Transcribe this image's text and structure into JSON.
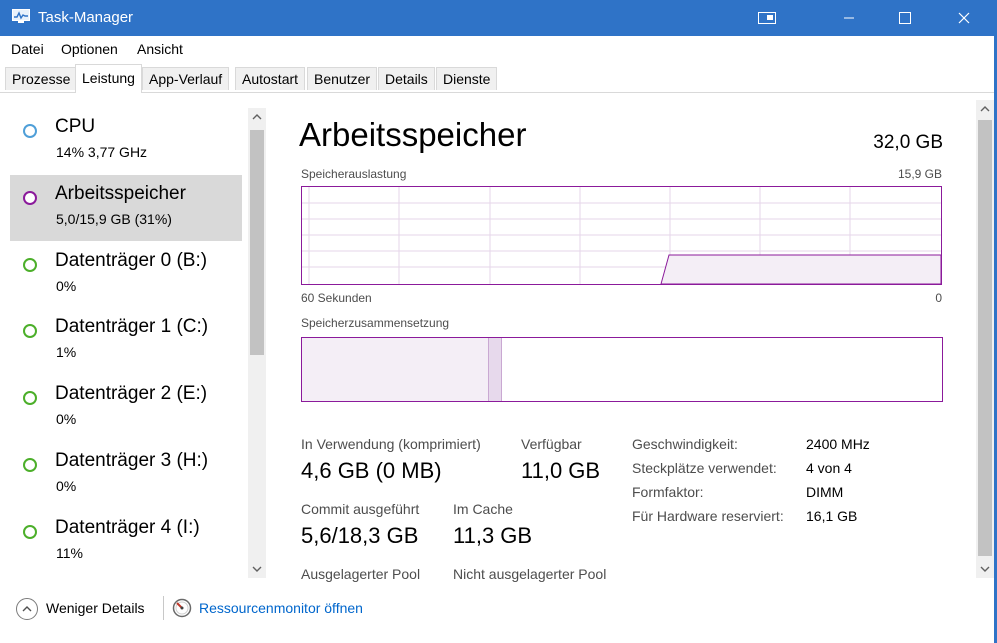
{
  "window": {
    "title": "Task-Manager"
  },
  "menu": [
    "Datei",
    "Optionen",
    "Ansicht"
  ],
  "tabs": [
    {
      "label": "Prozesse"
    },
    {
      "label": "Leistung",
      "active": true
    },
    {
      "label": "App-Verlauf"
    },
    {
      "label": "Autostart"
    },
    {
      "label": "Benutzer"
    },
    {
      "label": "Details"
    },
    {
      "label": "Dienste"
    }
  ],
  "resources": [
    {
      "name": "CPU",
      "sub": "14%  3,77 GHz",
      "color": "#4f9fd8"
    },
    {
      "name": "Arbeitsspeicher",
      "sub": "5,0/15,9 GB (31%)",
      "color": "#8b1a9b",
      "selected": true
    },
    {
      "name": "Datenträger 0 (B:)",
      "sub": "0%",
      "color": "#4caf2a"
    },
    {
      "name": "Datenträger 1 (C:)",
      "sub": "1%",
      "color": "#4caf2a"
    },
    {
      "name": "Datenträger 2 (E:)",
      "sub": "0%",
      "color": "#4caf2a"
    },
    {
      "name": "Datenträger 3 (H:)",
      "sub": "0%",
      "color": "#4caf2a"
    },
    {
      "name": "Datenträger 4 (I:)",
      "sub": "11%",
      "color": "#4caf2a"
    }
  ],
  "main": {
    "title": "Arbeitsspeicher",
    "total": "32,0 GB",
    "usage_label": "Speicherauslastung",
    "usage_max": "15,9 GB",
    "time_left": "60 Sekunden",
    "time_right": "0",
    "composition_label": "Speicherzusammensetzung",
    "accent_color": "#8b1a9b",
    "usage_fraction": 0.31
  },
  "stats": {
    "in_use_label": "In Verwendung (komprimiert)",
    "in_use_value": "4,6 GB (0 MB)",
    "available_label": "Verfügbar",
    "available_value": "11,0 GB",
    "commit_label": "Commit ausgeführt",
    "commit_value": "5,6/18,3 GB",
    "cache_label": "Im Cache",
    "cache_value": "11,3 GB",
    "paged_label": "Ausgelagerter Pool",
    "nonpaged_label": "Nicht ausgelagerter Pool"
  },
  "specs": [
    {
      "label": "Geschwindigkeit:",
      "value": "2400 MHz"
    },
    {
      "label": "Steckplätze verwendet:",
      "value": "4 von 4"
    },
    {
      "label": "Formfaktor:",
      "value": "DIMM"
    },
    {
      "label": "Für Hardware reserviert:",
      "value": "16,1 GB"
    }
  ],
  "footer": {
    "fewer_details": "Weniger Details",
    "resource_monitor": "Ressourcenmonitor öffnen"
  }
}
